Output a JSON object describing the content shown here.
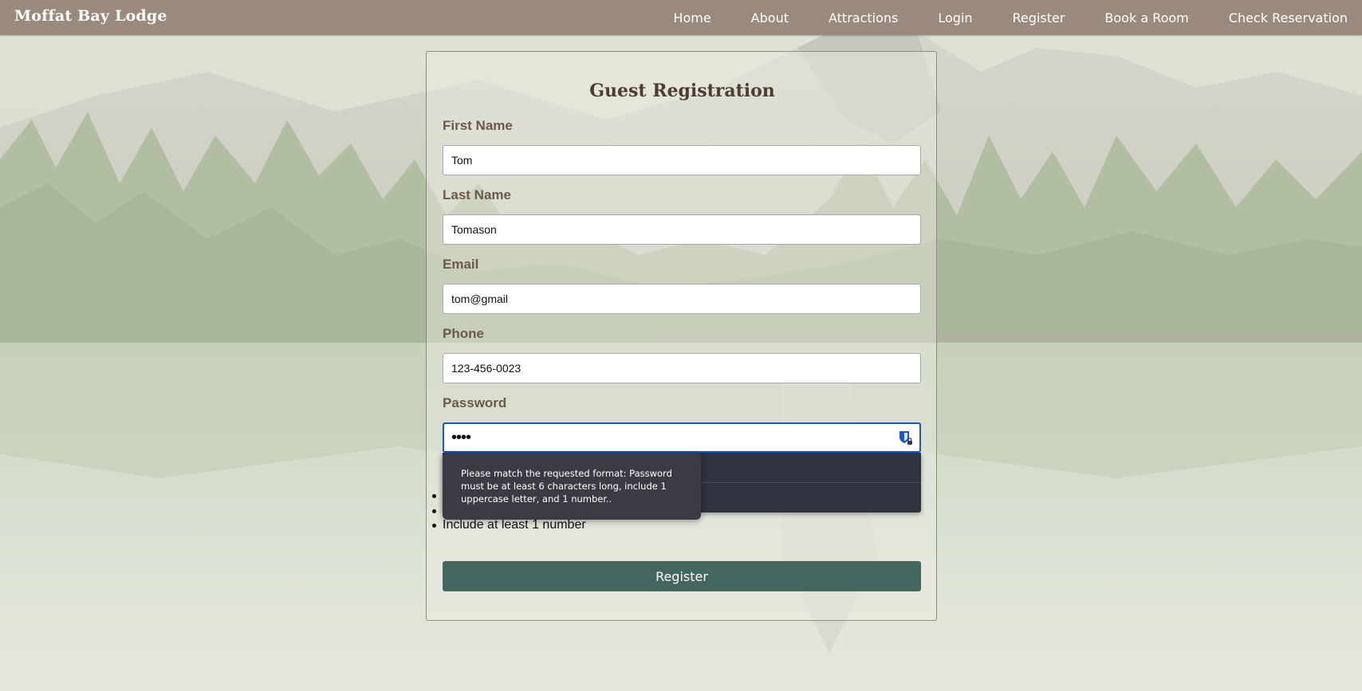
{
  "nav": {
    "brand": "Moffat Bay Lodge",
    "links": [
      "Home",
      "About",
      "Attractions",
      "Login",
      "Register",
      "Book a Room",
      "Check Reservation"
    ]
  },
  "form": {
    "title": "Guest Registration",
    "fields": {
      "first_name": {
        "label": "First Name",
        "value": "Tom"
      },
      "last_name": {
        "label": "Last Name",
        "value": "Tomason"
      },
      "email": {
        "label": "Email",
        "value": "tom@gmail"
      },
      "phone": {
        "label": "Phone",
        "value": "123-456-0023"
      },
      "password": {
        "label": "Password",
        "masked_value": "••••"
      }
    },
    "password_rules": [
      "",
      "",
      "Include at least 1 number"
    ],
    "submit_label": "Register"
  },
  "tooltip": {
    "message": "Please match the requested format: Password must be at least 6 characters long, include 1 uppercase letter, and 1 number.."
  },
  "colors": {
    "nav_bg": "#9a8a7e",
    "button_bg": "#45665e",
    "focus_border": "#1a56c8",
    "title": "#4e3e30",
    "label": "#6b5a4b"
  }
}
